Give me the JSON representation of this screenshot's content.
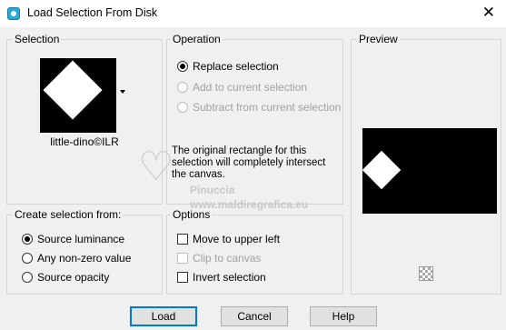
{
  "window": {
    "title": "Load Selection From Disk",
    "close_glyph": "✕"
  },
  "selection": {
    "legend": "Selection",
    "thumbnail_label": "little-dino©ILR"
  },
  "operation": {
    "legend": "Operation",
    "options": [
      {
        "label": "Replace selection",
        "checked": true,
        "enabled": true
      },
      {
        "label": "Add to current selection",
        "checked": false,
        "enabled": false
      },
      {
        "label": "Subtract from current selection",
        "checked": false,
        "enabled": false
      }
    ],
    "info": "The original rectangle for this selection will completely intersect the canvas."
  },
  "preview": {
    "legend": "Preview"
  },
  "create_from": {
    "legend": "Create selection from:",
    "options": [
      {
        "label": "Source luminance",
        "checked": true
      },
      {
        "label": "Any non-zero value",
        "checked": false
      },
      {
        "label": "Source opacity",
        "checked": false
      }
    ]
  },
  "options": {
    "legend": "Options",
    "items": [
      {
        "label": "Move to upper left",
        "checked": false,
        "enabled": true
      },
      {
        "label": "Clip to canvas",
        "checked": false,
        "enabled": false
      },
      {
        "label": "Invert selection",
        "checked": false,
        "enabled": true
      }
    ]
  },
  "watermark": {
    "mark": "♡",
    "name": "Pinuccia",
    "url": "www.maldiregrafica.eu"
  },
  "buttons": {
    "load": "Load",
    "cancel": "Cancel",
    "help": "Help"
  },
  "icons": {
    "app": "selection-app-icon",
    "close": "close-icon",
    "dropdown": "chevron-down-icon",
    "checker": "transparency-checker-icon"
  }
}
